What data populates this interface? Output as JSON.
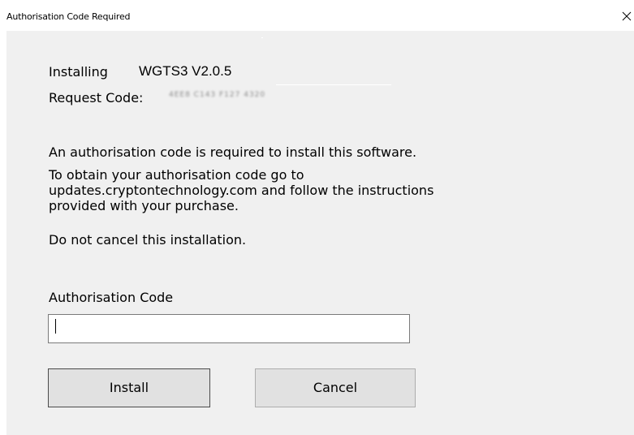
{
  "window": {
    "title": "Authorisation Code Required",
    "close_icon": "close-icon"
  },
  "install_info": {
    "installing_label": "Installing",
    "product_name": "WGTS3 V2.0.5",
    "request_code_label": "Request Code:",
    "request_code_value": "4EE8 C143 F127 4320"
  },
  "message": {
    "line1": "An authorisation code is required to install this software.",
    "line2": "To obtain your authorisation code go to\nupdates.cryptontechnology.com and follow the instructions\nprovided with your purchase.",
    "line3": "Do not cancel this installation."
  },
  "auth_code": {
    "label": "Authorisation Code",
    "value": ""
  },
  "buttons": {
    "install_label": "Install",
    "cancel_label": "Cancel"
  },
  "colors": {
    "client_background": "#f0f0f0",
    "button_face": "#e1e1e1",
    "button_border": "#adadad",
    "default_button_border": "#4a4a4a"
  }
}
